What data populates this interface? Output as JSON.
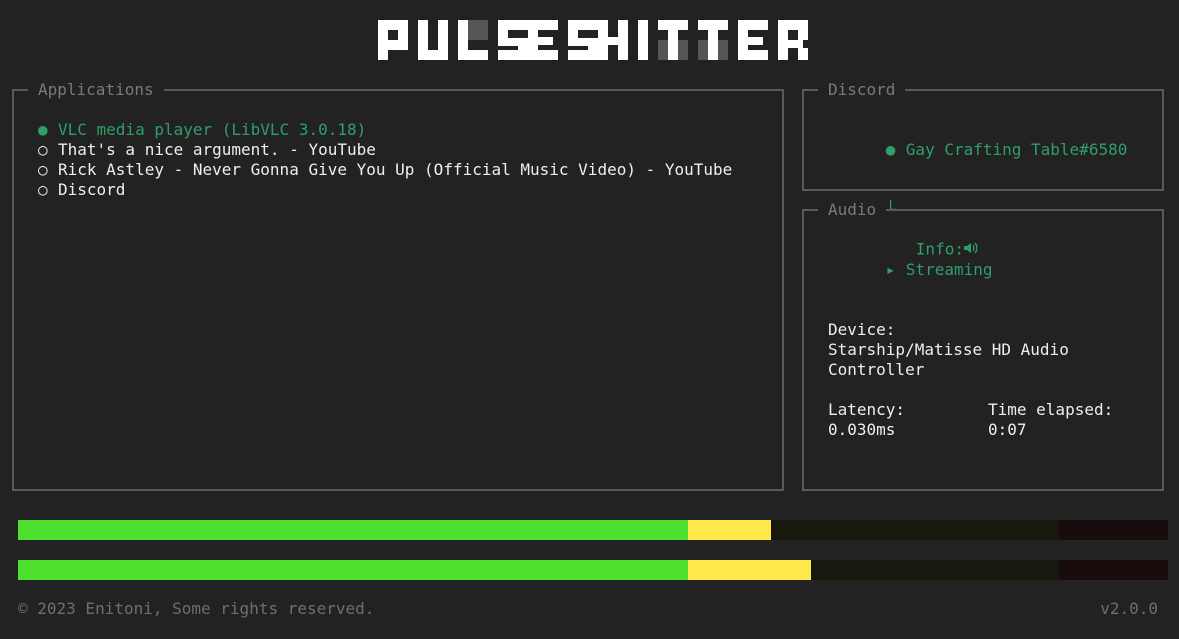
{
  "header": {
    "logo_text": "PULSESHITTER"
  },
  "applications": {
    "title": "Applications",
    "items": [
      {
        "marker": "●",
        "label": "VLC media player (LibVLC 3.0.18)",
        "active": true
      },
      {
        "marker": "○",
        "label": "That's a nice argument. - YouTube",
        "active": false
      },
      {
        "marker": "○",
        "label": "Rick Astley - Never Gonna Give You Up (Official Music Video) - YouTube",
        "active": false
      },
      {
        "marker": "○",
        "label": "Discord",
        "active": false
      }
    ]
  },
  "discord": {
    "title": "Discord",
    "user_marker": "●",
    "user": "Gay Crafting Table#6580",
    "info_tree": "└",
    "info_icon": "speaker-icon",
    "info_label": "Info:"
  },
  "audio": {
    "title": "Audio",
    "state_marker": "▸",
    "state": "Streaming",
    "device_label": "Device:",
    "device_value": "Starship/Matisse HD Audio Controller",
    "latency_label": "Latency:",
    "latency_value": "0.030ms",
    "elapsed_label": "Time elapsed:",
    "elapsed_value": "0:07"
  },
  "meters": {
    "colors": {
      "green": "#4ee02e",
      "yellow": "#ffe94a",
      "dim": "#18180f",
      "dim_red": "#190c0c"
    },
    "left_level": 0.655,
    "right_level": 0.69
  },
  "footer": {
    "copyright": "© 2023 Enitoni, Some rights reserved.",
    "version": "v2.0.0"
  }
}
